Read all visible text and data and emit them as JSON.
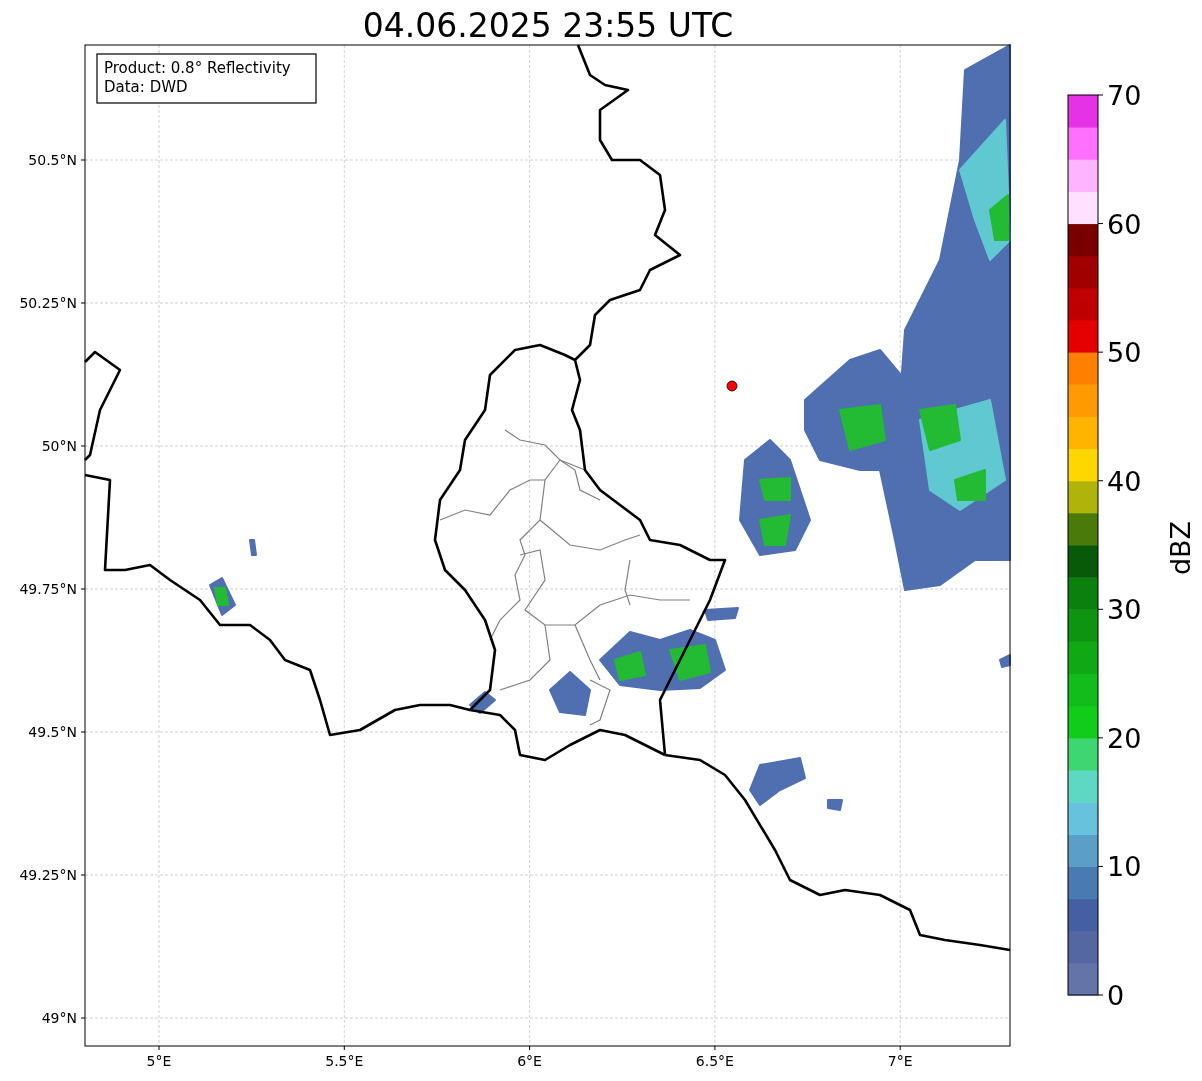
{
  "title": "04.06.2025 23:55 UTC",
  "info_box": {
    "lines": [
      "Product: 0.8° Reflectivity",
      "Data: DWD"
    ]
  },
  "y_ticks": [
    "50.5°N",
    "50.25°N",
    "50°N",
    "49.75°N",
    "49.5°N",
    "49.25°N",
    "49°N"
  ],
  "x_ticks": [
    "5°E",
    "5.5°E",
    "6°E",
    "6.5°E",
    "7°E"
  ],
  "colorbar": {
    "label": "dBZ",
    "tick_labels": [
      "70",
      "60",
      "50",
      "40",
      "30",
      "20",
      "10",
      "0"
    ],
    "bins": [
      {
        "color": "#6473a8"
      },
      {
        "color": "#5467a3"
      },
      {
        "color": "#4460a3"
      },
      {
        "color": "#4a7ab2"
      },
      {
        "color": "#5b9fc8"
      },
      {
        "color": "#67c3dd"
      },
      {
        "color": "#5fd8c3"
      },
      {
        "color": "#3ed671"
      },
      {
        "color": "#12cc1b"
      },
      {
        "color": "#12bc1b"
      },
      {
        "color": "#10a815"
      },
      {
        "color": "#0e9411"
      },
      {
        "color": "#0c800e"
      },
      {
        "color": "#085a09"
      },
      {
        "color": "#4a7a0a"
      },
      {
        "color": "#b0b40a"
      },
      {
        "color": "#ffd700"
      },
      {
        "color": "#ffb400"
      },
      {
        "color": "#ff9a00"
      },
      {
        "color": "#ff8000"
      },
      {
        "color": "#e40000"
      },
      {
        "color": "#c00000"
      },
      {
        "color": "#a00000"
      },
      {
        "color": "#7a0000"
      },
      {
        "color": "#ffe0ff"
      },
      {
        "color": "#ffb4ff"
      },
      {
        "color": "#ff70ff"
      },
      {
        "color": "#e632e6"
      }
    ]
  }
}
